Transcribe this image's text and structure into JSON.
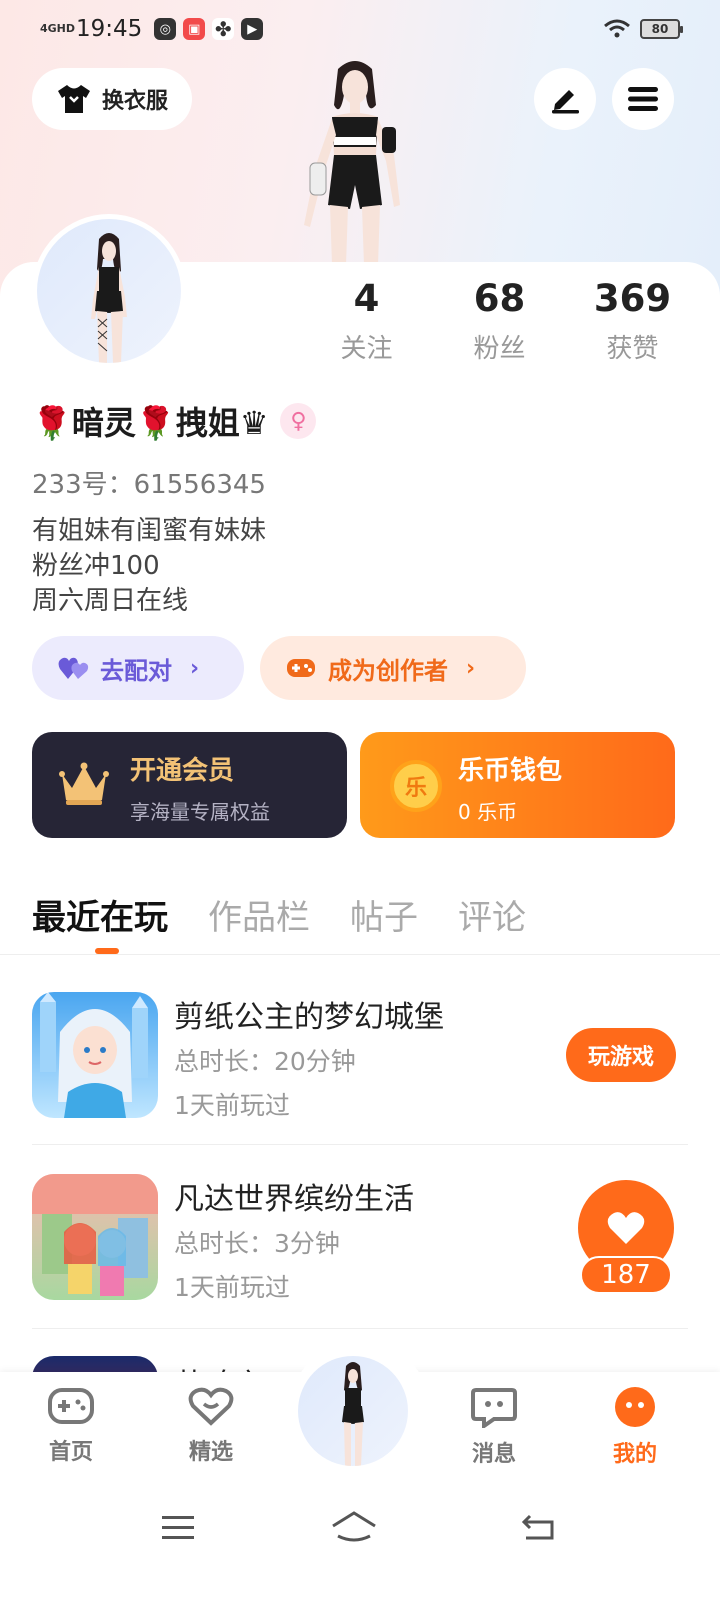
{
  "status_bar": {
    "network": "4GHD",
    "time": "19:45",
    "battery": "80"
  },
  "header": {
    "outfit_button": "换衣服"
  },
  "stats": [
    {
      "value": "4",
      "label": "关注"
    },
    {
      "value": "68",
      "label": "粉丝"
    },
    {
      "value": "369",
      "label": "获赞"
    }
  ],
  "profile": {
    "name": "🌹暗灵🌹拽姐♛",
    "gender_symbol": "♀",
    "uid": "233号：61556345",
    "bio": [
      "有姐妹有闺蜜有妹妹",
      "粉丝冲100",
      "周六周日在线"
    ]
  },
  "pills": {
    "match": "去配对",
    "creator": "成为创作者"
  },
  "cards": {
    "vip_title": "开通会员",
    "vip_sub": "享海量专属权益",
    "wallet_title": "乐币钱包",
    "wallet_sub": "0 乐币",
    "coin_glyph": "乐"
  },
  "tabs": [
    "最近在玩",
    "作品栏",
    "帖子",
    "评论"
  ],
  "games": [
    {
      "title": "剪纸公主的梦幻城堡",
      "duration": "总时长：20分钟",
      "last_played": "1天前玩过",
      "button": "玩游戏"
    },
    {
      "title": "凡达世界缤纷生活",
      "duration": "总时长：3分钟",
      "last_played": "1天前玩过"
    },
    {
      "title": "英魂之刃"
    }
  ],
  "like_count": "187",
  "bottom_nav": [
    "首页",
    "精选",
    "消息",
    "我的"
  ],
  "colors": {
    "accent": "#ff6a1a",
    "vip_bg": "#262536",
    "gold": "#f3c276"
  }
}
